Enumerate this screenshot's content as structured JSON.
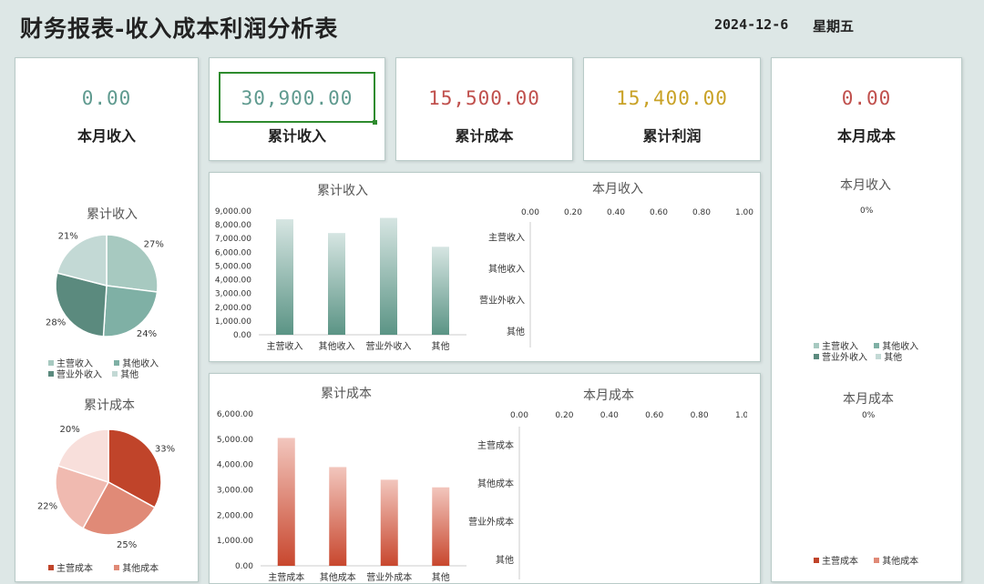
{
  "header": {
    "title": "财务报表-收入成本利润分析表",
    "date": "2024-12-6",
    "weekday": "星期五"
  },
  "kpis": {
    "month_income": {
      "value": "0.00",
      "label": "本月收入"
    },
    "cum_income": {
      "value": "30,900.00",
      "label": "累计收入"
    },
    "cum_cost": {
      "value": "15,500.00",
      "label": "累计成本"
    },
    "cum_profit": {
      "value": "15,400.00",
      "label": "累计利润"
    },
    "month_cost": {
      "value": "0.00",
      "label": "本月成本"
    }
  },
  "colors": {
    "green_value": "#5f9a8f",
    "red_value": "#c0504d",
    "gold_value": "#c9a227",
    "income_palette": [
      "#a7c9c0",
      "#7fb0a5",
      "#5b8a7e",
      "#c3d9d5"
    ],
    "cost_palette": [
      "#c0442a",
      "#e08a77",
      "#f0bab0",
      "#f8dfdb"
    ]
  },
  "chart_data": [
    {
      "type": "pie",
      "title": "累计收入",
      "labels": [
        "主营收入",
        "其他收入",
        "营业外收入",
        "其他"
      ],
      "values": [
        27,
        24,
        28,
        21
      ],
      "value_labels": [
        "27%",
        "24%",
        "28%",
        "21%"
      ],
      "legend": "bottom"
    },
    {
      "type": "pie",
      "title": "累计成本",
      "labels": [
        "主营成本",
        "其他成本",
        "营业外成本",
        "其他"
      ],
      "values": [
        33,
        25,
        22,
        20
      ],
      "value_labels": [
        "33%",
        "25%",
        "22%",
        "20%"
      ],
      "legend": "bottom"
    },
    {
      "type": "bar",
      "title": "累计收入",
      "categories": [
        "主营收入",
        "其他收入",
        "营业外收入",
        "其他"
      ],
      "values": [
        8400,
        7400,
        8500,
        6400
      ],
      "ylim": [
        0,
        9000
      ],
      "yticks": [
        "0.00",
        "1,000.00",
        "2,000.00",
        "3,000.00",
        "4,000.00",
        "5,000.00",
        "6,000.00",
        "7,000.00",
        "8,000.00",
        "9,000.00"
      ],
      "grid": false
    },
    {
      "type": "bar",
      "orientation": "horizontal",
      "title": "本月收入",
      "categories": [
        "主营收入",
        "其他收入",
        "营业外收入",
        "其他"
      ],
      "values": [
        0,
        0,
        0,
        0
      ],
      "xlim": [
        0,
        1
      ],
      "xticks": [
        "0.00",
        "0.20",
        "0.40",
        "0.60",
        "0.80",
        "1.00"
      ]
    },
    {
      "type": "pie",
      "title": "本月收入",
      "labels": [
        "主营收入",
        "其他收入",
        "营业外收入",
        "其他"
      ],
      "values": [
        0,
        0,
        0,
        0
      ],
      "value_labels": [
        "0%"
      ],
      "legend": "bottom"
    },
    {
      "type": "bar",
      "title": "累计成本",
      "categories": [
        "主营成本",
        "其他成本",
        "营业外成本",
        "其他"
      ],
      "values": [
        5050,
        3900,
        3400,
        3100
      ],
      "ylim": [
        0,
        6000
      ],
      "yticks": [
        "0.00",
        "1,000.00",
        "2,000.00",
        "3,000.00",
        "4,000.00",
        "5,000.00",
        "6,000.00"
      ],
      "grid": false
    },
    {
      "type": "bar",
      "orientation": "horizontal",
      "title": "本月成本",
      "categories": [
        "主营成本",
        "其他成本",
        "营业外成本",
        "其他"
      ],
      "values": [
        0,
        0,
        0,
        0
      ],
      "xlim": [
        0,
        1
      ],
      "xticks": [
        "0.00",
        "0.20",
        "0.40",
        "0.60",
        "0.80",
        "1.00"
      ]
    },
    {
      "type": "pie",
      "title": "本月成本",
      "labels": [
        "主营成本",
        "其他成本",
        "营业外成本",
        "其他"
      ],
      "values": [
        0,
        0,
        0,
        0
      ],
      "value_labels": [
        "0%"
      ],
      "legend": "bottom"
    }
  ]
}
